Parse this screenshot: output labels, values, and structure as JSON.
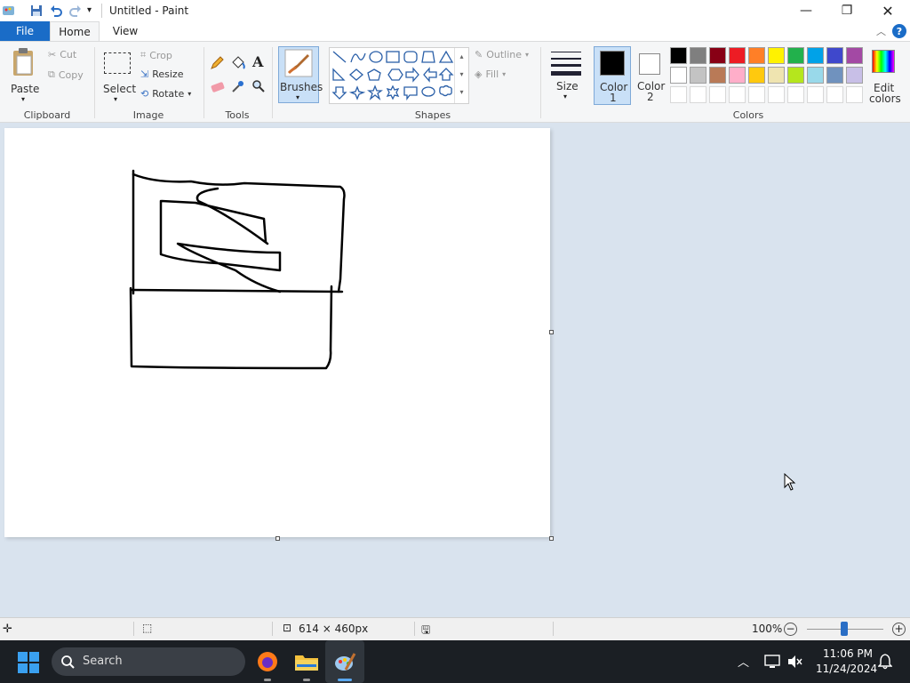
{
  "window": {
    "title": "Untitled - Paint"
  },
  "menu": {
    "tabs": [
      "File",
      "Home",
      "View"
    ]
  },
  "clipboard": {
    "paste": "Paste",
    "cut": "Cut",
    "copy": "Copy",
    "group": "Clipboard"
  },
  "image": {
    "select": "Select",
    "crop": "Crop",
    "resize": "Resize",
    "rotate": "Rotate",
    "group": "Image"
  },
  "tools": {
    "group": "Tools"
  },
  "brushes": {
    "label": "Brushes"
  },
  "shapes": {
    "outline": "Outline",
    "fill": "Fill",
    "group": "Shapes"
  },
  "size": {
    "label": "Size"
  },
  "colors": {
    "color1": "Color",
    "color1_num": "1",
    "color2": "Color",
    "color2_num": "2",
    "edit": "Edit",
    "edit2": "colors",
    "group": "Colors",
    "row1": [
      "#000000",
      "#7f7f7f",
      "#880015",
      "#ed1c24",
      "#ff7f27",
      "#fff200",
      "#22b14c",
      "#00a2e8",
      "#3f48cc",
      "#a349a4"
    ],
    "row2": [
      "#ffffff",
      "#c3c3c3",
      "#b97a57",
      "#ffaec9",
      "#ffc90e",
      "#efe4b0",
      "#b5e61d",
      "#99d9ea",
      "#7092be",
      "#c8bfe7"
    ]
  },
  "status": {
    "dimensions": "614 × 460px",
    "zoom": "100%"
  },
  "taskbar": {
    "search": "Search",
    "time": "11:06 PM",
    "date": "11/24/2024"
  }
}
